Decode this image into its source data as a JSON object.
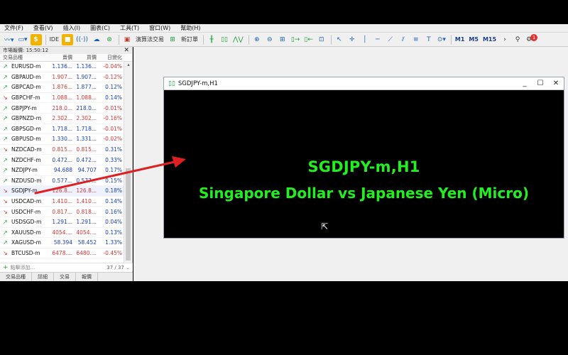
{
  "menu": {
    "items": [
      "文件(F)",
      "查看(V)",
      "插入(I)",
      "圖表(C)",
      "工具(T)",
      "窗口(W)",
      "幫助(H)"
    ]
  },
  "toolbar": {
    "ide_label": "IDE",
    "algo_label": "演算法交易",
    "new_order_label": "新訂單",
    "timeframes": [
      "M1",
      "M5",
      "M15"
    ],
    "notification_count": "1"
  },
  "market_watch": {
    "title": "市場報價: 15:50:12",
    "columns": {
      "symbol": "交易品種",
      "bid": "賣價",
      "ask": "買價",
      "change": "日變化"
    },
    "rows": [
      {
        "symbol": "EURUSD-m",
        "dir": "up",
        "bid": "1.136...",
        "ask": "1.136...",
        "change": "-0.04%",
        "bid_color": "blue",
        "ask_color": "blue",
        "change_sign": "neg"
      },
      {
        "symbol": "GBPAUD-m",
        "dir": "up",
        "bid": "1.907...",
        "ask": "1.907...",
        "change": "-0.12%",
        "bid_color": "red",
        "ask_color": "blue",
        "change_sign": "neg"
      },
      {
        "symbol": "GBPCAD-m",
        "dir": "up",
        "bid": "1.876...",
        "ask": "1.877...",
        "change": "0.12%",
        "bid_color": "red",
        "ask_color": "blue",
        "change_sign": "pos"
      },
      {
        "symbol": "GBPCHF-m",
        "dir": "down",
        "bid": "1.088...",
        "ask": "1.088...",
        "change": "0.14%",
        "bid_color": "red",
        "ask_color": "red",
        "change_sign": "pos"
      },
      {
        "symbol": "GBPJPY-m",
        "dir": "up",
        "bid": "218.0...",
        "ask": "218.0...",
        "change": "-0.01%",
        "bid_color": "red",
        "ask_color": "blue",
        "change_sign": "neg"
      },
      {
        "symbol": "GBPNZD-m",
        "dir": "up",
        "bid": "2.302...",
        "ask": "2.302...",
        "change": "-0.16%",
        "bid_color": "red",
        "ask_color": "red",
        "change_sign": "neg"
      },
      {
        "symbol": "GBPSGD-m",
        "dir": "up",
        "bid": "1.718...",
        "ask": "1.718...",
        "change": "-0.01%",
        "bid_color": "blue",
        "ask_color": "blue",
        "change_sign": "neg"
      },
      {
        "symbol": "GBPUSD-m",
        "dir": "up",
        "bid": "1.330...",
        "ask": "1.331...",
        "change": "-0.02%",
        "bid_color": "blue",
        "ask_color": "blue",
        "change_sign": "neg"
      },
      {
        "symbol": "NZDCAD-m",
        "dir": "down",
        "bid": "0.815...",
        "ask": "0.815...",
        "change": "0.31%",
        "bid_color": "red",
        "ask_color": "red",
        "change_sign": "pos"
      },
      {
        "symbol": "NZDCHF-m",
        "dir": "up",
        "bid": "0.472...",
        "ask": "0.472...",
        "change": "0.33%",
        "bid_color": "blue",
        "ask_color": "blue",
        "change_sign": "pos"
      },
      {
        "symbol": "NZDJPY-m",
        "dir": "up",
        "bid": "94.688",
        "ask": "94.707",
        "change": "0.17%",
        "bid_color": "blue",
        "ask_color": "blue",
        "change_sign": "pos"
      },
      {
        "symbol": "NZDUSD-m",
        "dir": "up",
        "bid": "0.577...",
        "ask": "0.577...",
        "change": "0.15%",
        "bid_color": "blue",
        "ask_color": "blue",
        "change_sign": "pos"
      },
      {
        "symbol": "SGDJPY-m",
        "dir": "down",
        "bid": "126.8...",
        "ask": "126.8...",
        "change": "0.18%",
        "bid_color": "red",
        "ask_color": "red",
        "change_sign": "pos"
      },
      {
        "symbol": "USDCAD-m",
        "dir": "down",
        "bid": "1.410...",
        "ask": "1.410...",
        "change": "0.14%",
        "bid_color": "red",
        "ask_color": "red",
        "change_sign": "pos"
      },
      {
        "symbol": "USDCHF-m",
        "dir": "down",
        "bid": "0.817...",
        "ask": "0.818...",
        "change": "0.16%",
        "bid_color": "red",
        "ask_color": "red",
        "change_sign": "pos"
      },
      {
        "symbol": "USDSGD-m",
        "dir": "up",
        "bid": "1.291...",
        "ask": "1.291...",
        "change": "0.04%",
        "bid_color": "blue",
        "ask_color": "blue",
        "change_sign": "pos"
      },
      {
        "symbol": "XAUUSD-m",
        "dir": "up",
        "bid": "4054....",
        "ask": "4054....",
        "change": "0.13%",
        "bid_color": "red",
        "ask_color": "red",
        "change_sign": "pos"
      },
      {
        "symbol": "XAGUSD-m",
        "dir": "up",
        "bid": "58.394",
        "ask": "58.452",
        "change": "1.33%",
        "bid_color": "blue",
        "ask_color": "blue",
        "change_sign": "pos"
      },
      {
        "symbol": "BTCUSD-m",
        "dir": "down",
        "bid": "6478....",
        "ask": "6480....",
        "change": "-0.45%",
        "bid_color": "red",
        "ask_color": "red",
        "change_sign": "neg"
      }
    ],
    "add_placeholder": "點擊添加...",
    "count": "37 / 37",
    "tabs": [
      "交易品種",
      "詳細",
      "交易",
      "報價"
    ]
  },
  "chart_window": {
    "title": "SGDJPY-m,H1",
    "overlay_line1": "SGDJPY-m,H1",
    "overlay_line2": "Singapore Dollar vs Japanese Yen (Micro)"
  },
  "colors": {
    "overlay_text": "#22ee22",
    "annotation_arrow": "#e02020",
    "up_arrow": "#1f9d3a",
    "down_arrow": "#d03030"
  }
}
